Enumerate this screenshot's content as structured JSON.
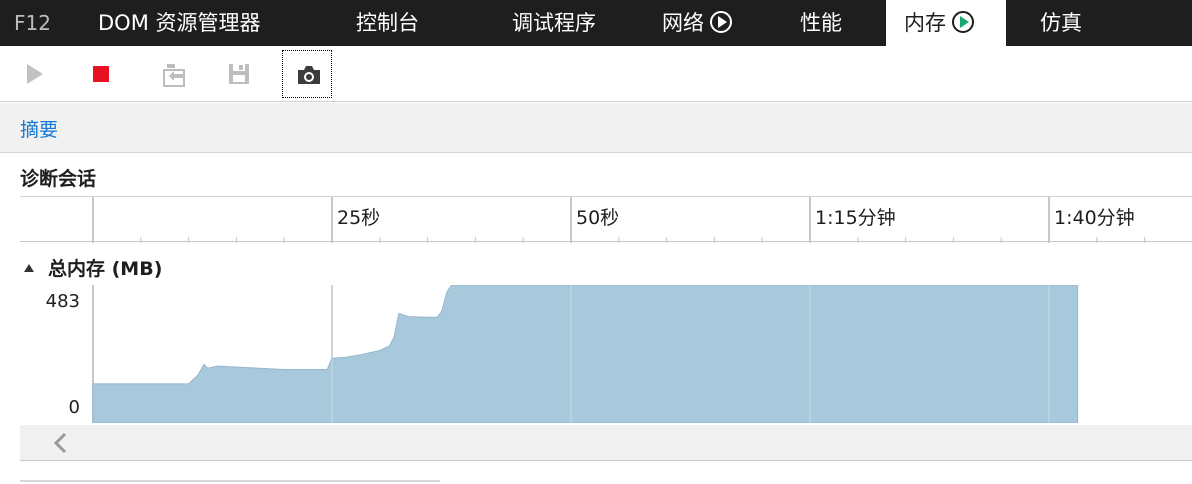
{
  "tabs": [
    {
      "label": "F12"
    },
    {
      "label": "DOM 资源管理器"
    },
    {
      "label": "控制台"
    },
    {
      "label": "调试程序"
    },
    {
      "label": "网络"
    },
    {
      "label": "性能"
    },
    {
      "label": "内存"
    },
    {
      "label": "仿真"
    }
  ],
  "active_tab": "内存",
  "toolbar": {
    "icons": [
      "play-icon",
      "stop-icon",
      "import-icon",
      "save-icon",
      "camera-icon"
    ],
    "stop_color": "#e81123"
  },
  "summary": {
    "label": "摘要",
    "color": "#1478d4"
  },
  "session": {
    "title": "诊断会话",
    "ruler_labels": [
      "25秒",
      "50秒",
      "1:15分钟",
      "1:40分钟"
    ]
  },
  "memory": {
    "header": "总内存 (MB)",
    "ymax_label": "483",
    "ymin_label": "0",
    "fill_color": "#a8c8dc"
  },
  "chart_data": {
    "type": "area",
    "title": "总内存 (MB)",
    "xlabel": "",
    "ylabel": "",
    "ylim": [
      0,
      483
    ],
    "xlim": [
      0,
      112
    ],
    "x_ticks": [
      "25秒",
      "50秒",
      "1:15分钟",
      "1:40分钟"
    ],
    "x_tick_values": [
      25,
      50,
      75,
      100
    ],
    "grid": true,
    "x": [
      0,
      10,
      10.5,
      11,
      11.6,
      12,
      13,
      20,
      22,
      24.5,
      25,
      26.5,
      28,
      30,
      31,
      31.5,
      32,
      33,
      35,
      36,
      36.5,
      37,
      37.5,
      38.5,
      40,
      50,
      60,
      70,
      80,
      90,
      100,
      103
    ],
    "values": [
      150,
      150,
      168,
      185,
      225,
      210,
      218,
      205,
      205,
      205,
      248,
      252,
      262,
      278,
      295,
      330,
      420,
      408,
      405,
      405,
      430,
      500,
      545,
      550,
      552,
      550,
      548,
      545,
      545,
      547,
      545,
      545
    ]
  }
}
